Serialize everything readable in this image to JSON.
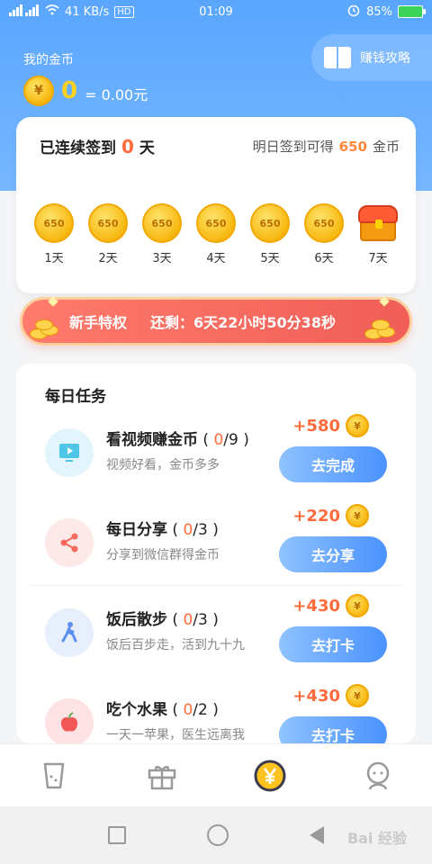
{
  "status": {
    "signal": "4G",
    "network_speed": "41 KB/s",
    "time": "01:09",
    "battery": "85%"
  },
  "header": {
    "label": "我的金币",
    "coin_count": "0",
    "money": "= 0.00元",
    "strategy_btn": "赚钱攻略"
  },
  "signin": {
    "prefix": "已连续签到",
    "days": "0",
    "suffix": "天",
    "tip_prefix": "明日签到可得",
    "tip_amount": "650",
    "tip_suffix": "金币",
    "days_list": [
      {
        "amount": "650",
        "label": "1天"
      },
      {
        "amount": "650",
        "label": "2天"
      },
      {
        "amount": "650",
        "label": "3天"
      },
      {
        "amount": "650",
        "label": "4天"
      },
      {
        "amount": "650",
        "label": "5天"
      },
      {
        "amount": "650",
        "label": "6天"
      },
      {
        "label": "7天"
      }
    ]
  },
  "promo": {
    "title": "新手特权",
    "countdown": "还剩：6天22小时50分38秒"
  },
  "tasks": {
    "title": "每日任务",
    "items": [
      {
        "name": "看视频赚金币",
        "done": "0",
        "total": "/9",
        "desc": "视频好看，金币多多",
        "reward": "+580",
        "button": "去完成",
        "icon": "video-icon"
      },
      {
        "name": "每日分享",
        "done": "0",
        "total": "/3",
        "desc": "分享到微信群得金币",
        "reward": "+220",
        "button": "去分享",
        "icon": "share-icon"
      },
      {
        "name": "饭后散步",
        "done": "0",
        "total": "/3",
        "desc": "饭后百步走，活到九十九",
        "reward": "+430",
        "button": "去打卡",
        "icon": "walk-icon"
      },
      {
        "name": "吃个水果",
        "done": "0",
        "total": "/2",
        "desc": "一天一苹果，医生远离我",
        "reward": "+430",
        "button": "去打卡",
        "icon": "apple-icon"
      }
    ]
  },
  "tab_bar": {
    "items": [
      "cup-icon",
      "gift-icon",
      "yuan-coin-icon",
      "profile-icon"
    ]
  },
  "watermark": "Bai 经验",
  "colors": {
    "hero": "#5aa6ff",
    "accent": "#ff6b3d",
    "button": "#4a92ff",
    "banner": "#f05e57"
  }
}
